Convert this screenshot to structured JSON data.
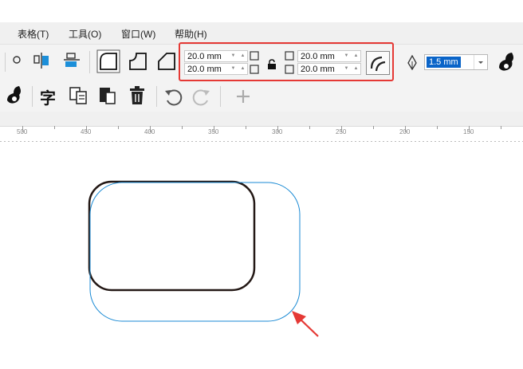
{
  "menu": [
    {
      "label": "表格(T)"
    },
    {
      "label": "工具(O)"
    },
    {
      "label": "窗口(W)"
    },
    {
      "label": "帮助(H)"
    }
  ],
  "corner": {
    "width_top": "20.0 mm",
    "height_top": "20.0 mm",
    "width_bottom": "20.0 mm",
    "height_bottom": "20.0 mm"
  },
  "outline_width": "1.5 mm",
  "ruler": {
    "labels": [
      "500",
      "450",
      "400",
      "350",
      "300",
      "250",
      "200",
      "150"
    ]
  },
  "colors": {
    "highlight": "#e53935",
    "selected_outline": "#1a8ad4",
    "shape_outline": "#231815",
    "annotation_arrow": "#e53935",
    "input_selection": "#0a64c8"
  },
  "icons": [
    "circle-icon",
    "align-nodes-icon",
    "distribute-icon",
    "round-corner-icon",
    "scallop-corner-icon",
    "chamfer-corner-icon",
    "lock-icon",
    "scale-corners-icon",
    "pen-nib-icon",
    "artistic-media-icon",
    "text-icon",
    "copy-properties-icon",
    "paste-icon",
    "delete-icon",
    "undo-icon",
    "redo-icon",
    "add-icon"
  ]
}
